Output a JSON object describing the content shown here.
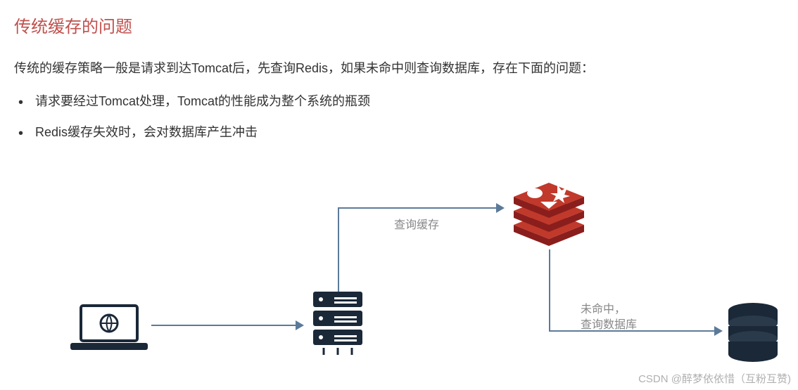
{
  "title": "传统缓存的问题",
  "description": "传统的缓存策略一般是请求到达Tomcat后，先查询Redis，如果未命中则查询数据库，存在下面的问题：",
  "bullets": [
    "请求要经过Tomcat处理，Tomcat的性能成为整个系统的瓶颈",
    "Redis缓存失效时，会对数据库产生冲击"
  ],
  "diagram": {
    "nodes": {
      "client": "laptop-client",
      "server": "tomcat-server",
      "cache": "redis-cache",
      "database": "database"
    },
    "labels": {
      "query_cache": "查询缓存",
      "miss_query_db": "未命中，\n查询数据库"
    }
  },
  "watermark": "CSDN @醉梦依依惜（互粉互赞)"
}
